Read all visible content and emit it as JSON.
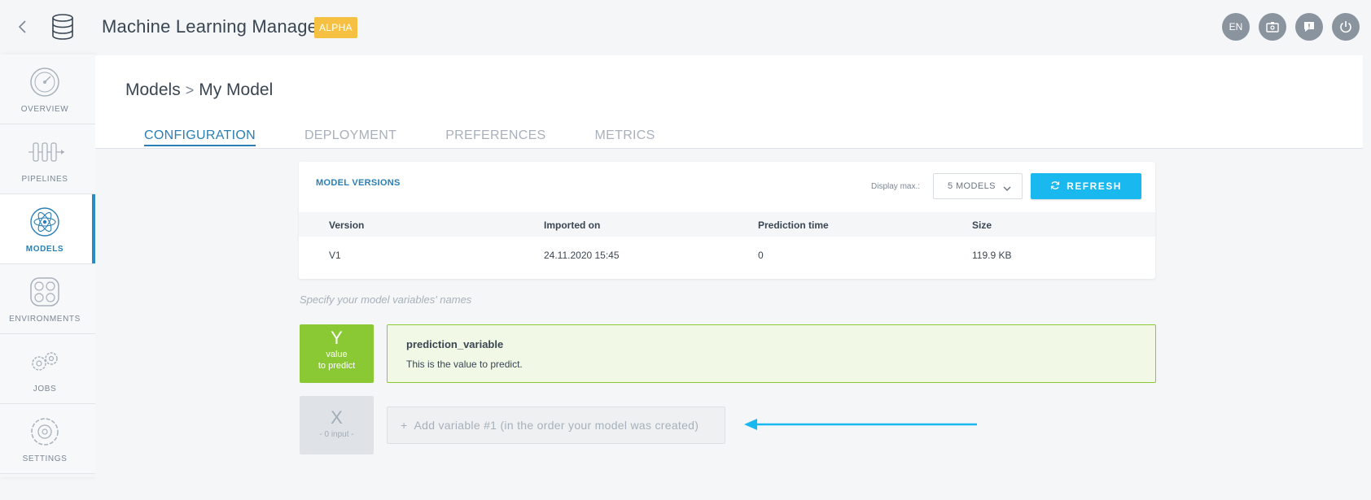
{
  "header": {
    "app_title": "Machine Learning Manager",
    "badge": "ALPHA",
    "language": "EN",
    "icons": [
      "back-chevron-icon",
      "database-logo-icon",
      "id-card-icon",
      "feedback-icon",
      "power-icon"
    ]
  },
  "sidebar": {
    "items": [
      {
        "label": "OVERVIEW",
        "icon": "speedometer-icon",
        "active": false
      },
      {
        "label": "PIPELINES",
        "icon": "pipeline-icon",
        "active": false
      },
      {
        "label": "MODELS",
        "icon": "atom-icon",
        "active": true
      },
      {
        "label": "ENVIRONMENTS",
        "icon": "nodes-icon",
        "active": false
      },
      {
        "label": "JOBS",
        "icon": "gears-icon",
        "active": false
      },
      {
        "label": "SETTINGS",
        "icon": "settings-gear-icon",
        "active": false
      }
    ]
  },
  "main": {
    "breadcrumb": {
      "parent": "Models",
      "separator": ">",
      "current": "My Model"
    },
    "tabs": [
      {
        "label": "CONFIGURATION",
        "active": true
      },
      {
        "label": "DEPLOYMENT",
        "active": false
      },
      {
        "label": "PREFERENCES",
        "active": false
      },
      {
        "label": "METRICS",
        "active": false
      }
    ]
  },
  "model_versions": {
    "title": "MODEL VERSIONS",
    "display_max_label": "Display max.:",
    "display_max_value": "5 MODELS",
    "refresh_label": "REFRESH",
    "columns": [
      "Version",
      "Imported on",
      "Prediction time",
      "Size"
    ],
    "rows": [
      {
        "version": "V1",
        "imported_on": "24.11.2020 15:45",
        "prediction_time": "0",
        "size": "119.9 KB"
      }
    ]
  },
  "variables": {
    "hint": "Specify your model variables' names",
    "y": {
      "letter": "Y",
      "sub_line1": "value",
      "sub_line2": "to predict",
      "name": "prediction_variable",
      "description": "This is the value to predict."
    },
    "x": {
      "letter": "X",
      "sub": "- 0 input -",
      "add_prefix": "+",
      "add_placeholder": "Add variable #1 (in the order your model was created)"
    }
  },
  "colors": {
    "accent_blue": "#2a7fb4",
    "refresh_cyan": "#19b8ee",
    "y_green": "#8bc934",
    "y_panel_bg": "#f1f8e6",
    "alpha_yellow": "#f6c143",
    "arrow_blue": "#19b8ee"
  }
}
